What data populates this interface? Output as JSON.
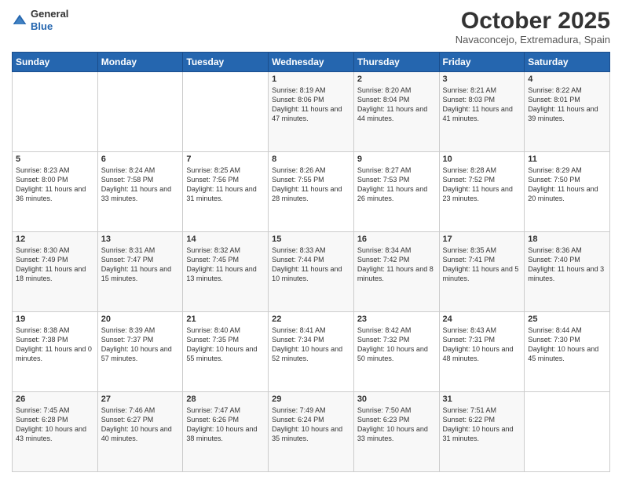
{
  "header": {
    "logo": {
      "line1": "General",
      "line2": "Blue"
    },
    "title": "October 2025",
    "location": "Navaconcejo, Extremadura, Spain"
  },
  "weekdays": [
    "Sunday",
    "Monday",
    "Tuesday",
    "Wednesday",
    "Thursday",
    "Friday",
    "Saturday"
  ],
  "weeks": [
    [
      {
        "day": "",
        "sunrise": "",
        "sunset": "",
        "daylight": ""
      },
      {
        "day": "",
        "sunrise": "",
        "sunset": "",
        "daylight": ""
      },
      {
        "day": "",
        "sunrise": "",
        "sunset": "",
        "daylight": ""
      },
      {
        "day": "1",
        "sunrise": "Sunrise: 8:19 AM",
        "sunset": "Sunset: 8:06 PM",
        "daylight": "Daylight: 11 hours and 47 minutes."
      },
      {
        "day": "2",
        "sunrise": "Sunrise: 8:20 AM",
        "sunset": "Sunset: 8:04 PM",
        "daylight": "Daylight: 11 hours and 44 minutes."
      },
      {
        "day": "3",
        "sunrise": "Sunrise: 8:21 AM",
        "sunset": "Sunset: 8:03 PM",
        "daylight": "Daylight: 11 hours and 41 minutes."
      },
      {
        "day": "4",
        "sunrise": "Sunrise: 8:22 AM",
        "sunset": "Sunset: 8:01 PM",
        "daylight": "Daylight: 11 hours and 39 minutes."
      }
    ],
    [
      {
        "day": "5",
        "sunrise": "Sunrise: 8:23 AM",
        "sunset": "Sunset: 8:00 PM",
        "daylight": "Daylight: 11 hours and 36 minutes."
      },
      {
        "day": "6",
        "sunrise": "Sunrise: 8:24 AM",
        "sunset": "Sunset: 7:58 PM",
        "daylight": "Daylight: 11 hours and 33 minutes."
      },
      {
        "day": "7",
        "sunrise": "Sunrise: 8:25 AM",
        "sunset": "Sunset: 7:56 PM",
        "daylight": "Daylight: 11 hours and 31 minutes."
      },
      {
        "day": "8",
        "sunrise": "Sunrise: 8:26 AM",
        "sunset": "Sunset: 7:55 PM",
        "daylight": "Daylight: 11 hours and 28 minutes."
      },
      {
        "day": "9",
        "sunrise": "Sunrise: 8:27 AM",
        "sunset": "Sunset: 7:53 PM",
        "daylight": "Daylight: 11 hours and 26 minutes."
      },
      {
        "day": "10",
        "sunrise": "Sunrise: 8:28 AM",
        "sunset": "Sunset: 7:52 PM",
        "daylight": "Daylight: 11 hours and 23 minutes."
      },
      {
        "day": "11",
        "sunrise": "Sunrise: 8:29 AM",
        "sunset": "Sunset: 7:50 PM",
        "daylight": "Daylight: 11 hours and 20 minutes."
      }
    ],
    [
      {
        "day": "12",
        "sunrise": "Sunrise: 8:30 AM",
        "sunset": "Sunset: 7:49 PM",
        "daylight": "Daylight: 11 hours and 18 minutes."
      },
      {
        "day": "13",
        "sunrise": "Sunrise: 8:31 AM",
        "sunset": "Sunset: 7:47 PM",
        "daylight": "Daylight: 11 hours and 15 minutes."
      },
      {
        "day": "14",
        "sunrise": "Sunrise: 8:32 AM",
        "sunset": "Sunset: 7:45 PM",
        "daylight": "Daylight: 11 hours and 13 minutes."
      },
      {
        "day": "15",
        "sunrise": "Sunrise: 8:33 AM",
        "sunset": "Sunset: 7:44 PM",
        "daylight": "Daylight: 11 hours and 10 minutes."
      },
      {
        "day": "16",
        "sunrise": "Sunrise: 8:34 AM",
        "sunset": "Sunset: 7:42 PM",
        "daylight": "Daylight: 11 hours and 8 minutes."
      },
      {
        "day": "17",
        "sunrise": "Sunrise: 8:35 AM",
        "sunset": "Sunset: 7:41 PM",
        "daylight": "Daylight: 11 hours and 5 minutes."
      },
      {
        "day": "18",
        "sunrise": "Sunrise: 8:36 AM",
        "sunset": "Sunset: 7:40 PM",
        "daylight": "Daylight: 11 hours and 3 minutes."
      }
    ],
    [
      {
        "day": "19",
        "sunrise": "Sunrise: 8:38 AM",
        "sunset": "Sunset: 7:38 PM",
        "daylight": "Daylight: 11 hours and 0 minutes."
      },
      {
        "day": "20",
        "sunrise": "Sunrise: 8:39 AM",
        "sunset": "Sunset: 7:37 PM",
        "daylight": "Daylight: 10 hours and 57 minutes."
      },
      {
        "day": "21",
        "sunrise": "Sunrise: 8:40 AM",
        "sunset": "Sunset: 7:35 PM",
        "daylight": "Daylight: 10 hours and 55 minutes."
      },
      {
        "day": "22",
        "sunrise": "Sunrise: 8:41 AM",
        "sunset": "Sunset: 7:34 PM",
        "daylight": "Daylight: 10 hours and 52 minutes."
      },
      {
        "day": "23",
        "sunrise": "Sunrise: 8:42 AM",
        "sunset": "Sunset: 7:32 PM",
        "daylight": "Daylight: 10 hours and 50 minutes."
      },
      {
        "day": "24",
        "sunrise": "Sunrise: 8:43 AM",
        "sunset": "Sunset: 7:31 PM",
        "daylight": "Daylight: 10 hours and 48 minutes."
      },
      {
        "day": "25",
        "sunrise": "Sunrise: 8:44 AM",
        "sunset": "Sunset: 7:30 PM",
        "daylight": "Daylight: 10 hours and 45 minutes."
      }
    ],
    [
      {
        "day": "26",
        "sunrise": "Sunrise: 7:45 AM",
        "sunset": "Sunset: 6:28 PM",
        "daylight": "Daylight: 10 hours and 43 minutes."
      },
      {
        "day": "27",
        "sunrise": "Sunrise: 7:46 AM",
        "sunset": "Sunset: 6:27 PM",
        "daylight": "Daylight: 10 hours and 40 minutes."
      },
      {
        "day": "28",
        "sunrise": "Sunrise: 7:47 AM",
        "sunset": "Sunset: 6:26 PM",
        "daylight": "Daylight: 10 hours and 38 minutes."
      },
      {
        "day": "29",
        "sunrise": "Sunrise: 7:49 AM",
        "sunset": "Sunset: 6:24 PM",
        "daylight": "Daylight: 10 hours and 35 minutes."
      },
      {
        "day": "30",
        "sunrise": "Sunrise: 7:50 AM",
        "sunset": "Sunset: 6:23 PM",
        "daylight": "Daylight: 10 hours and 33 minutes."
      },
      {
        "day": "31",
        "sunrise": "Sunrise: 7:51 AM",
        "sunset": "Sunset: 6:22 PM",
        "daylight": "Daylight: 10 hours and 31 minutes."
      },
      {
        "day": "",
        "sunrise": "",
        "sunset": "",
        "daylight": ""
      }
    ]
  ]
}
